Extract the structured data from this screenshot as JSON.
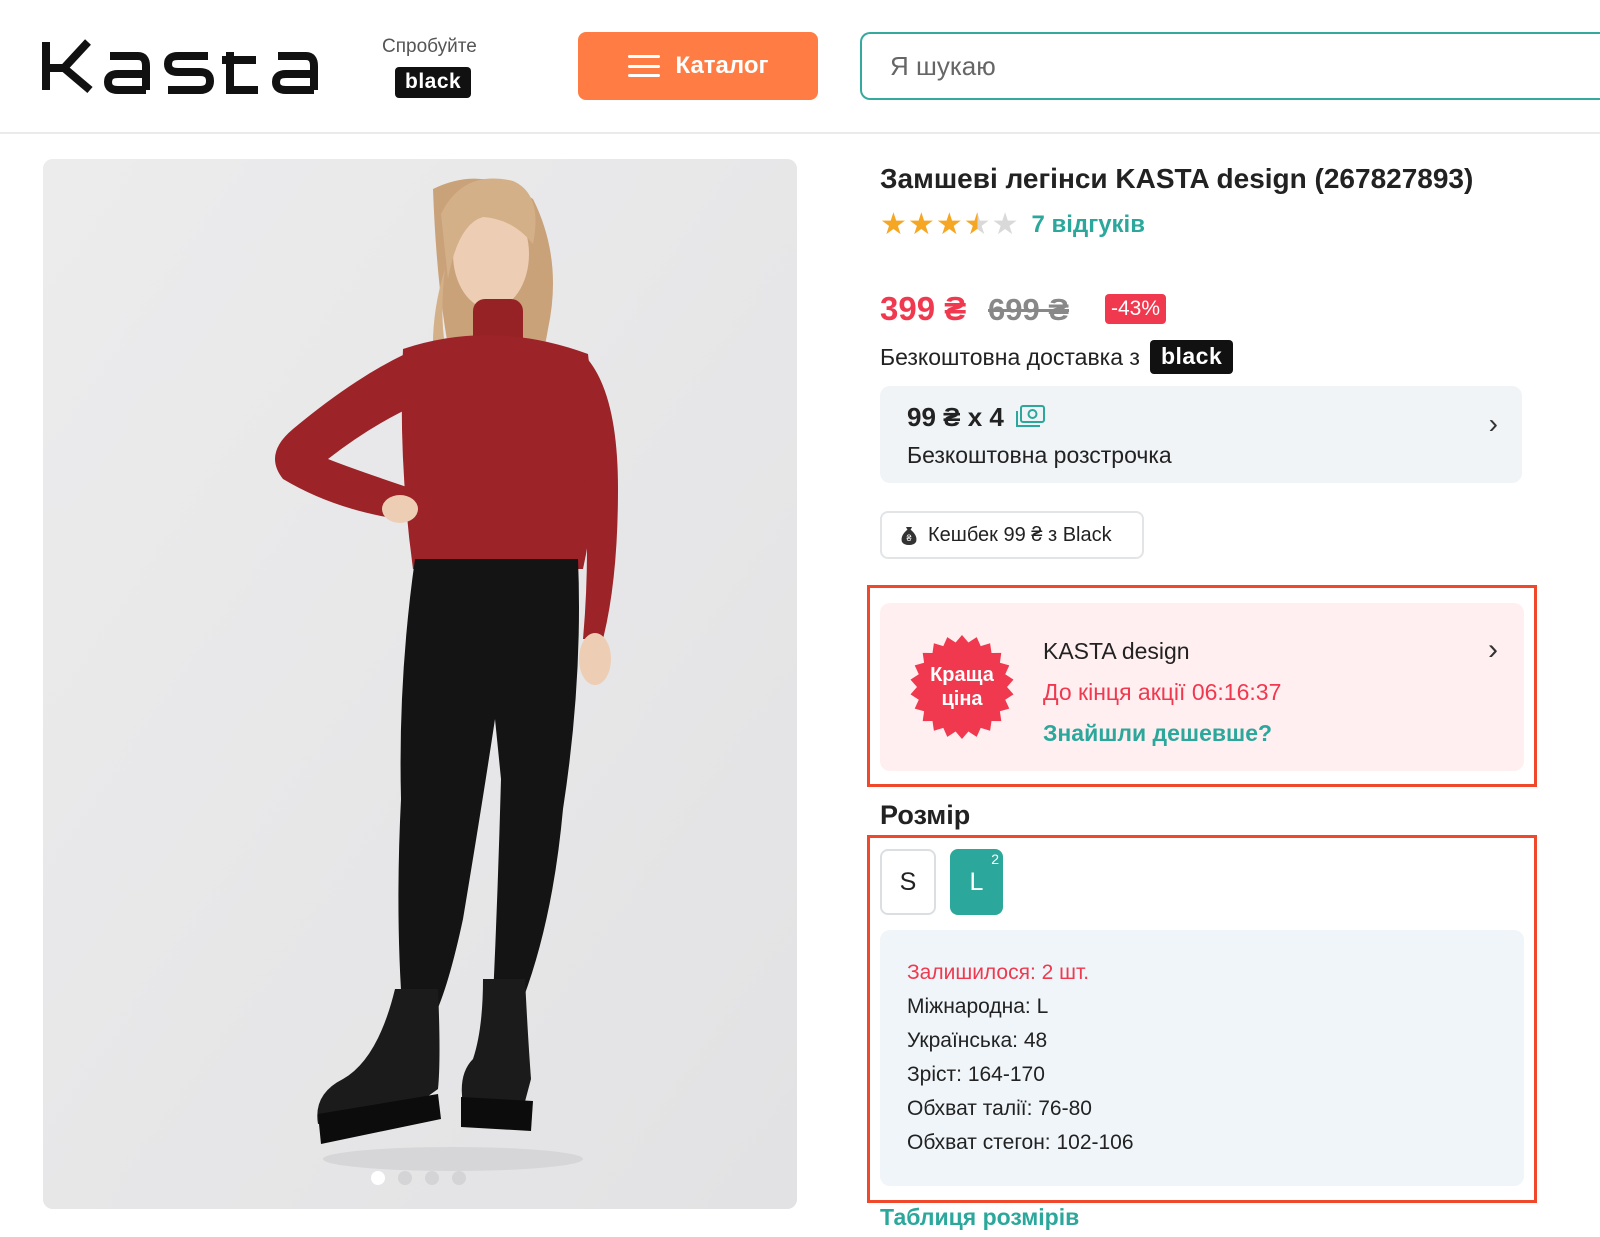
{
  "header": {
    "logo_text": "KASTA",
    "try_label": "Спробуйте",
    "black_label": "black",
    "catalog_label": "Каталог",
    "search_placeholder": "Я шукаю"
  },
  "gallery": {
    "slides_count": 4,
    "active_slide": 1
  },
  "product": {
    "title": "Замшеві легінси KASTA design (267827893)",
    "rating": 3.5,
    "rating_max": 5,
    "reviews_label": "7 відгуків",
    "price": "399 ₴",
    "old_price": "699 ₴",
    "discount": "-43%",
    "delivery_text": "Безкоштовна доставка з",
    "delivery_badge": "black",
    "installment": {
      "amount": "99 ₴ x 4",
      "label": "Безкоштовна розстрочка"
    },
    "cashback": "Кешбек 99 ₴ з Black"
  },
  "promo": {
    "stamp_line1": "Краща",
    "stamp_line2": "ціна",
    "seller": "KASTA design",
    "timer": "До кінця акції 06:16:37",
    "cheaper_link": "Знайшли дешевше?"
  },
  "size": {
    "heading": "Розмір",
    "options": [
      {
        "label": "S",
        "selected": false
      },
      {
        "label": "L",
        "selected": true,
        "count": "2"
      }
    ],
    "details": {
      "remaining": "Залишилося: 2 шт.",
      "international": "Міжнародна: L",
      "ukrainian": "Українська: 48",
      "height": "Зріст: 164-170",
      "waist": "Обхват талії: 76-80",
      "hips": "Обхват стегон: 102-106"
    },
    "table_link": "Таблиця розмірів"
  },
  "colors": {
    "accent_orange": "#ff7d45",
    "accent_teal": "#2ba89b",
    "sale_red": "#f0384e",
    "highlight_outline": "#f0482a"
  }
}
